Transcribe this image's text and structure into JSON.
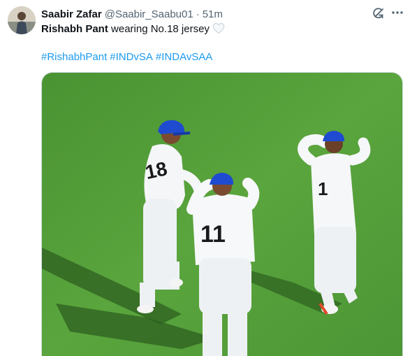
{
  "tweet": {
    "author_name": "Saabir Zafar",
    "handle": "@Saabir_Saabu01",
    "separator": "·",
    "time": "51m",
    "text_bold": "Rishabh Pant",
    "text_rest": " wearing No.18 jersey",
    "emoji": "white-heart",
    "hashtags": [
      "#RishabhPant",
      "#INDvSA",
      "#INDAvSAA"
    ]
  },
  "media": {
    "jersey_numbers": [
      "18",
      "11",
      "1"
    ]
  },
  "icons": {
    "grok": "grok-icon",
    "more": "more-icon"
  },
  "colors": {
    "link": "#1d9bf0",
    "secondary_text": "#536471",
    "pitch_green": "#4f9a36"
  }
}
